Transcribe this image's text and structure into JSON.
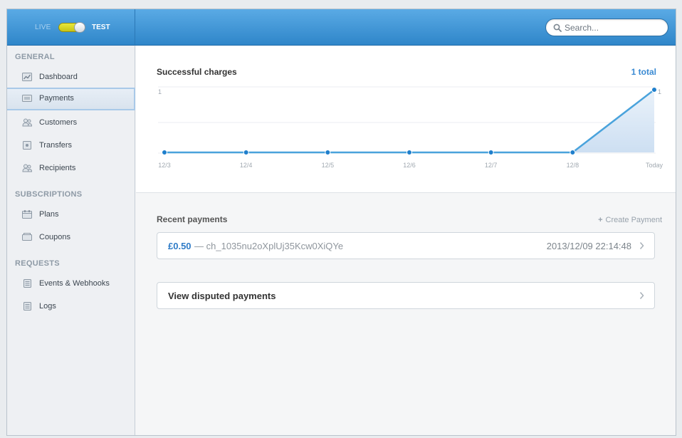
{
  "header": {
    "mode_live": "LIVE",
    "mode_test": "TEST",
    "search_placeholder": "Search..."
  },
  "sidebar": {
    "sections": [
      {
        "title": "GENERAL",
        "items": [
          {
            "label": "Dashboard",
            "icon": "dashboard-icon"
          },
          {
            "label": "Payments",
            "icon": "payments-icon",
            "active": true
          },
          {
            "label": "Customers",
            "icon": "customers-icon"
          },
          {
            "label": "Transfers",
            "icon": "transfers-icon"
          },
          {
            "label": "Recipients",
            "icon": "recipients-icon"
          }
        ]
      },
      {
        "title": "SUBSCRIPTIONS",
        "items": [
          {
            "label": "Plans",
            "icon": "plans-icon"
          },
          {
            "label": "Coupons",
            "icon": "coupons-icon"
          }
        ]
      },
      {
        "title": "REQUESTS",
        "items": [
          {
            "label": "Events & Webhooks",
            "icon": "events-icon"
          },
          {
            "label": "Logs",
            "icon": "logs-icon"
          }
        ]
      }
    ]
  },
  "main": {
    "chart_title": "Successful charges",
    "chart_total": "1 total",
    "recent_title": "Recent payments",
    "create_payment": "Create Payment",
    "payment": {
      "amount": "£0.50",
      "separator": "—",
      "charge_id": "ch_1035nu2oXplUj35Kcw0XiQYe",
      "date": "2013/12/09 22:14:48"
    },
    "disputed_label": "View disputed payments"
  },
  "chart_data": {
    "type": "line",
    "title": "Successful charges",
    "categories": [
      "12/3",
      "12/4",
      "12/5",
      "12/6",
      "12/7",
      "12/8",
      "Today"
    ],
    "values": [
      0,
      0,
      0,
      0,
      0,
      0,
      1
    ],
    "y_max_label": "1",
    "end_value_label": "1",
    "ylim": [
      0,
      1
    ],
    "grid": true,
    "colors": {
      "line": "#4aa3dc",
      "fill": "#d7e6f5",
      "point": "#1f7fcc"
    }
  },
  "colors": {
    "accent": "#2e7bc7",
    "header_top": "#5aaae5",
    "header_bottom": "#2f86c9"
  }
}
